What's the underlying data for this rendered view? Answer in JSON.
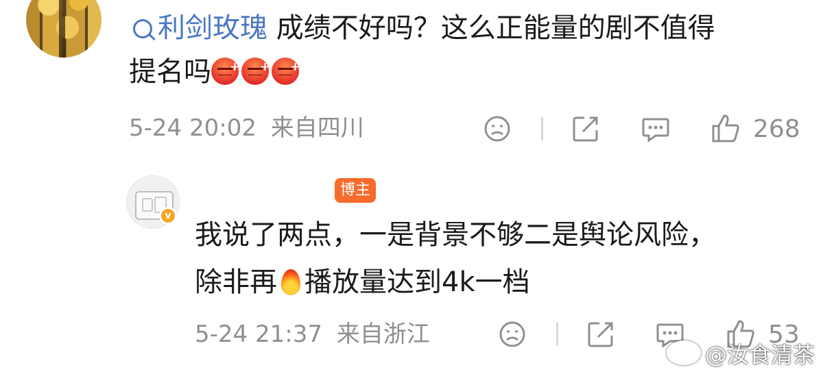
{
  "comment1": {
    "username": "利剑玫瑰",
    "text_line1": "成绩不好吗？这么正能量的剧不值得",
    "text_line2": "提名吗",
    "emoji_name": "angry-face-emoji",
    "date": "5-24 20:02",
    "location": "来自四川",
    "like_count": "268"
  },
  "comment2": {
    "badge_label": "博主",
    "text_line1": "我说了两点，一是背景不够二是舆论风险，",
    "text_line2_a": "除非再",
    "text_line2_b": "播放量达到4k一档",
    "emoji_name": "fire-emoji",
    "date": "5-24 21:37",
    "location": "来自浙江",
    "like_count": "53"
  },
  "watermark": {
    "text": "@汝食清茶",
    "icon": "weibo-logo"
  },
  "colors": {
    "link": "#4a77c2",
    "meta": "#8f8f8f",
    "badge": "#f76b2c"
  }
}
